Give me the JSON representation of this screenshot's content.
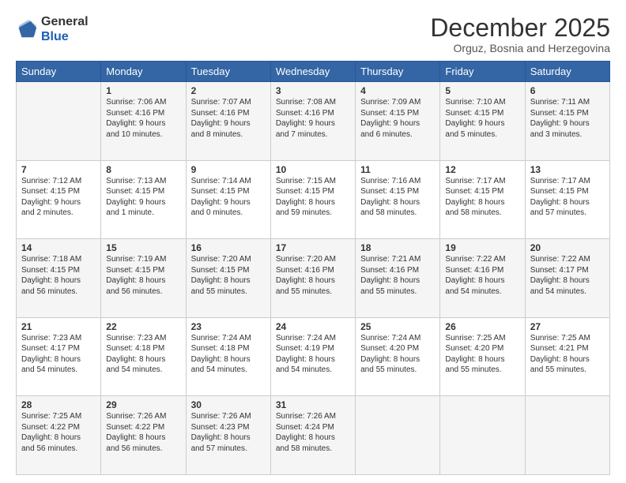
{
  "header": {
    "logo_general": "General",
    "logo_blue": "Blue",
    "month_title": "December 2025",
    "location": "Orguz, Bosnia and Herzegovina"
  },
  "weekdays": [
    "Sunday",
    "Monday",
    "Tuesday",
    "Wednesday",
    "Thursday",
    "Friday",
    "Saturday"
  ],
  "weeks": [
    [
      {
        "day": "",
        "info": ""
      },
      {
        "day": "1",
        "info": "Sunrise: 7:06 AM\nSunset: 4:16 PM\nDaylight: 9 hours\nand 10 minutes."
      },
      {
        "day": "2",
        "info": "Sunrise: 7:07 AM\nSunset: 4:16 PM\nDaylight: 9 hours\nand 8 minutes."
      },
      {
        "day": "3",
        "info": "Sunrise: 7:08 AM\nSunset: 4:16 PM\nDaylight: 9 hours\nand 7 minutes."
      },
      {
        "day": "4",
        "info": "Sunrise: 7:09 AM\nSunset: 4:15 PM\nDaylight: 9 hours\nand 6 minutes."
      },
      {
        "day": "5",
        "info": "Sunrise: 7:10 AM\nSunset: 4:15 PM\nDaylight: 9 hours\nand 5 minutes."
      },
      {
        "day": "6",
        "info": "Sunrise: 7:11 AM\nSunset: 4:15 PM\nDaylight: 9 hours\nand 3 minutes."
      }
    ],
    [
      {
        "day": "7",
        "info": "Sunrise: 7:12 AM\nSunset: 4:15 PM\nDaylight: 9 hours\nand 2 minutes."
      },
      {
        "day": "8",
        "info": "Sunrise: 7:13 AM\nSunset: 4:15 PM\nDaylight: 9 hours\nand 1 minute."
      },
      {
        "day": "9",
        "info": "Sunrise: 7:14 AM\nSunset: 4:15 PM\nDaylight: 9 hours\nand 0 minutes."
      },
      {
        "day": "10",
        "info": "Sunrise: 7:15 AM\nSunset: 4:15 PM\nDaylight: 8 hours\nand 59 minutes."
      },
      {
        "day": "11",
        "info": "Sunrise: 7:16 AM\nSunset: 4:15 PM\nDaylight: 8 hours\nand 58 minutes."
      },
      {
        "day": "12",
        "info": "Sunrise: 7:17 AM\nSunset: 4:15 PM\nDaylight: 8 hours\nand 58 minutes."
      },
      {
        "day": "13",
        "info": "Sunrise: 7:17 AM\nSunset: 4:15 PM\nDaylight: 8 hours\nand 57 minutes."
      }
    ],
    [
      {
        "day": "14",
        "info": "Sunrise: 7:18 AM\nSunset: 4:15 PM\nDaylight: 8 hours\nand 56 minutes."
      },
      {
        "day": "15",
        "info": "Sunrise: 7:19 AM\nSunset: 4:15 PM\nDaylight: 8 hours\nand 56 minutes."
      },
      {
        "day": "16",
        "info": "Sunrise: 7:20 AM\nSunset: 4:15 PM\nDaylight: 8 hours\nand 55 minutes."
      },
      {
        "day": "17",
        "info": "Sunrise: 7:20 AM\nSunset: 4:16 PM\nDaylight: 8 hours\nand 55 minutes."
      },
      {
        "day": "18",
        "info": "Sunrise: 7:21 AM\nSunset: 4:16 PM\nDaylight: 8 hours\nand 55 minutes."
      },
      {
        "day": "19",
        "info": "Sunrise: 7:22 AM\nSunset: 4:16 PM\nDaylight: 8 hours\nand 54 minutes."
      },
      {
        "day": "20",
        "info": "Sunrise: 7:22 AM\nSunset: 4:17 PM\nDaylight: 8 hours\nand 54 minutes."
      }
    ],
    [
      {
        "day": "21",
        "info": "Sunrise: 7:23 AM\nSunset: 4:17 PM\nDaylight: 8 hours\nand 54 minutes."
      },
      {
        "day": "22",
        "info": "Sunrise: 7:23 AM\nSunset: 4:18 PM\nDaylight: 8 hours\nand 54 minutes."
      },
      {
        "day": "23",
        "info": "Sunrise: 7:24 AM\nSunset: 4:18 PM\nDaylight: 8 hours\nand 54 minutes."
      },
      {
        "day": "24",
        "info": "Sunrise: 7:24 AM\nSunset: 4:19 PM\nDaylight: 8 hours\nand 54 minutes."
      },
      {
        "day": "25",
        "info": "Sunrise: 7:24 AM\nSunset: 4:20 PM\nDaylight: 8 hours\nand 55 minutes."
      },
      {
        "day": "26",
        "info": "Sunrise: 7:25 AM\nSunset: 4:20 PM\nDaylight: 8 hours\nand 55 minutes."
      },
      {
        "day": "27",
        "info": "Sunrise: 7:25 AM\nSunset: 4:21 PM\nDaylight: 8 hours\nand 55 minutes."
      }
    ],
    [
      {
        "day": "28",
        "info": "Sunrise: 7:25 AM\nSunset: 4:22 PM\nDaylight: 8 hours\nand 56 minutes."
      },
      {
        "day": "29",
        "info": "Sunrise: 7:26 AM\nSunset: 4:22 PM\nDaylight: 8 hours\nand 56 minutes."
      },
      {
        "day": "30",
        "info": "Sunrise: 7:26 AM\nSunset: 4:23 PM\nDaylight: 8 hours\nand 57 minutes."
      },
      {
        "day": "31",
        "info": "Sunrise: 7:26 AM\nSunset: 4:24 PM\nDaylight: 8 hours\nand 58 minutes."
      },
      {
        "day": "",
        "info": ""
      },
      {
        "day": "",
        "info": ""
      },
      {
        "day": "",
        "info": ""
      }
    ]
  ]
}
